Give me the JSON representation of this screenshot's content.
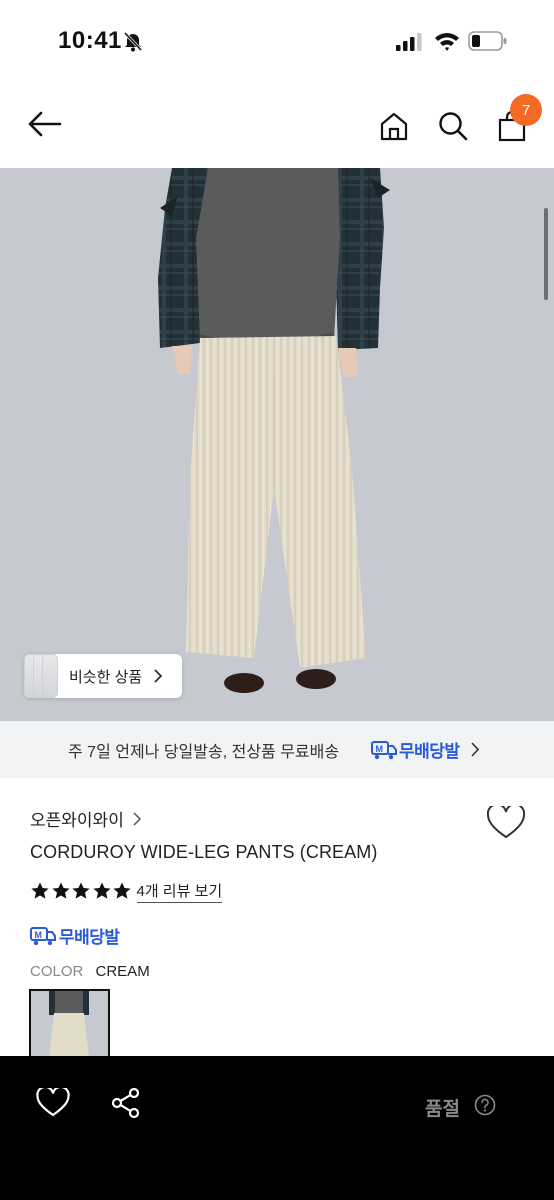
{
  "status_bar": {
    "time": "10:41"
  },
  "nav": {
    "cart_count": "7"
  },
  "image": {
    "similar_label": "비슷한 상품"
  },
  "delivery": {
    "text": "주 7일 언제나 당일발송, 전상품 무료배송",
    "logo_text": "무배당발"
  },
  "product": {
    "brand": "오픈와이와이",
    "title": "CORDUROY WIDE-LEG PANTS (CREAM)",
    "rating_stars": 5,
    "review_link": "4개 리뷰 보기",
    "badge": "무배당발",
    "color_label": "COLOR",
    "color_value": "CREAM"
  },
  "bottom_bar": {
    "status": "품절"
  },
  "colors": {
    "accent_orange": "#f26a24",
    "brand_blue": "#2a5bd7",
    "image_background": "#c6c9cf",
    "pants_cream": "#e4dccb",
    "bottom_bar": "#000000"
  }
}
